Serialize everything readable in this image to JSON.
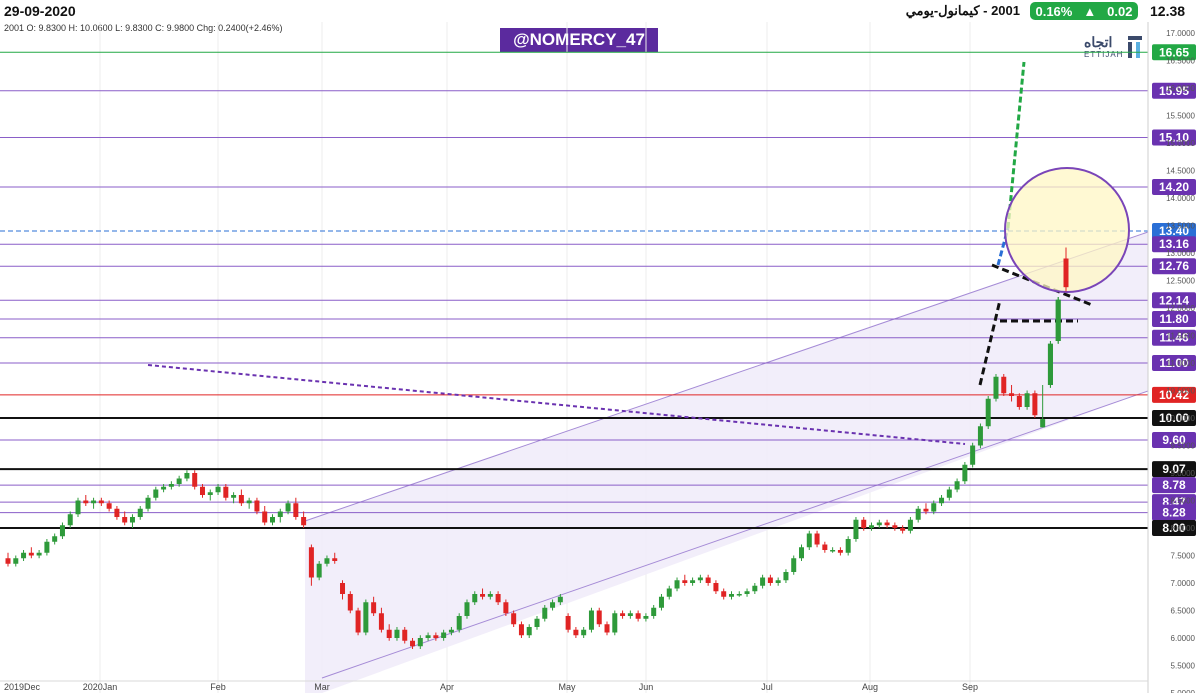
{
  "header": {
    "date": "29-09-2020",
    "title": "2001 - كيمانول-يومي",
    "change_pct": "0.16%",
    "change_abs": "0.02",
    "last_price": "12.38",
    "ohlc_line": "2001  O: 9.8300  H: 10.0600  L: 9.8300  C: 9.9800  Chg: 0.2400(+2.46%)"
  },
  "watermark": "@NOMERCY_47",
  "logo": {
    "arabic": "اتجاه",
    "english": "ETTIJAH"
  },
  "colors": {
    "up": "#2e9a3a",
    "down": "#e02424",
    "channel": "#a58bd6",
    "level": "#8a5ec8",
    "badge_purple": "#6a32b0",
    "badge_black": "#111111",
    "badge_red": "#e02424",
    "badge_green": "#22a845",
    "badge_blue": "#2a6fd6"
  },
  "chart_data": {
    "type": "candlestick",
    "x_labels": [
      "2019Dec",
      "2020Jan",
      "Feb",
      "Mar",
      "Apr",
      "May",
      "Jun",
      "Jul",
      "Aug",
      "Sep"
    ],
    "y_ticks": [
      "17.0000",
      "16.5000",
      "16.0000",
      "15.5000",
      "15.0000",
      "14.5000",
      "14.0000",
      "13.5000",
      "13.0000",
      "12.5000",
      "12.0000",
      "11.5000",
      "11.0000",
      "10.5000",
      "10.0000",
      "9.5000",
      "9.0000",
      "8.5000",
      "8.0000",
      "7.5000",
      "7.0000",
      "6.5000",
      "6.0000",
      "5.5000",
      "5.0000"
    ],
    "ylim": [
      5.0,
      17.2
    ],
    "price_levels": [
      {
        "value": 16.65,
        "label": "16.65",
        "style": "green"
      },
      {
        "value": 15.95,
        "label": "15.95",
        "style": "purple"
      },
      {
        "value": 15.1,
        "label": "15.10",
        "style": "purple"
      },
      {
        "value": 14.2,
        "label": "14.20",
        "style": "purple"
      },
      {
        "value": 13.4,
        "label": "13.40",
        "style": "blue"
      },
      {
        "value": 13.16,
        "label": "13.16",
        "style": "purple"
      },
      {
        "value": 12.76,
        "label": "12.76",
        "style": "purple"
      },
      {
        "value": 12.14,
        "label": "12.14",
        "style": "purple"
      },
      {
        "value": 11.8,
        "label": "11.80",
        "style": "purple"
      },
      {
        "value": 11.46,
        "label": "11.46",
        "style": "purple"
      },
      {
        "value": 11.0,
        "label": "11.00",
        "style": "purple"
      },
      {
        "value": 10.42,
        "label": "10.42",
        "style": "red"
      },
      {
        "value": 10.0,
        "label": "10.00",
        "style": "black"
      },
      {
        "value": 9.6,
        "label": "9.60",
        "style": "purple"
      },
      {
        "value": 9.07,
        "label": "9.07",
        "style": "black"
      },
      {
        "value": 8.78,
        "label": "8.78",
        "style": "purple"
      },
      {
        "value": 8.47,
        "label": "8.47",
        "style": "purple"
      },
      {
        "value": 8.28,
        "label": "8.28",
        "style": "purple"
      },
      {
        "value": 8.0,
        "label": "8.00",
        "style": "black"
      }
    ],
    "candles": [
      [
        7.45,
        7.55,
        7.3,
        7.35
      ],
      [
        7.35,
        7.5,
        7.3,
        7.45
      ],
      [
        7.45,
        7.6,
        7.4,
        7.55
      ],
      [
        7.55,
        7.65,
        7.45,
        7.5
      ],
      [
        7.5,
        7.6,
        7.45,
        7.55
      ],
      [
        7.55,
        7.8,
        7.5,
        7.75
      ],
      [
        7.75,
        7.9,
        7.7,
        7.85
      ],
      [
        7.85,
        8.1,
        7.8,
        8.05
      ],
      [
        8.05,
        8.3,
        8.0,
        8.25
      ],
      [
        8.25,
        8.55,
        8.2,
        8.5
      ],
      [
        8.5,
        8.6,
        8.4,
        8.45
      ],
      [
        8.45,
        8.55,
        8.35,
        8.5
      ],
      [
        8.5,
        8.55,
        8.4,
        8.45
      ],
      [
        8.45,
        8.5,
        8.3,
        8.35
      ],
      [
        8.35,
        8.4,
        8.15,
        8.2
      ],
      [
        8.2,
        8.3,
        8.05,
        8.1
      ],
      [
        8.1,
        8.25,
        8.0,
        8.2
      ],
      [
        8.2,
        8.4,
        8.15,
        8.35
      ],
      [
        8.35,
        8.6,
        8.3,
        8.55
      ],
      [
        8.55,
        8.75,
        8.5,
        8.7
      ],
      [
        8.7,
        8.8,
        8.65,
        8.75
      ],
      [
        8.75,
        8.85,
        8.7,
        8.8
      ],
      [
        8.8,
        8.95,
        8.75,
        8.9
      ],
      [
        8.9,
        9.05,
        8.85,
        9.0
      ],
      [
        9.0,
        9.05,
        8.7,
        8.75
      ],
      [
        8.75,
        8.8,
        8.55,
        8.6
      ],
      [
        8.6,
        8.7,
        8.5,
        8.65
      ],
      [
        8.65,
        8.8,
        8.6,
        8.75
      ],
      [
        8.75,
        8.8,
        8.5,
        8.55
      ],
      [
        8.55,
        8.65,
        8.45,
        8.6
      ],
      [
        8.6,
        8.7,
        8.4,
        8.45
      ],
      [
        8.45,
        8.55,
        8.35,
        8.5
      ],
      [
        8.5,
        8.55,
        8.25,
        8.3
      ],
      [
        8.3,
        8.4,
        8.05,
        8.1
      ],
      [
        8.1,
        8.25,
        8.05,
        8.2
      ],
      [
        8.2,
        8.35,
        8.1,
        8.3
      ],
      [
        8.3,
        8.5,
        8.25,
        8.45
      ],
      [
        8.45,
        8.55,
        8.15,
        8.2
      ],
      [
        8.2,
        8.3,
        8.0,
        8.05
      ],
      [
        7.65,
        7.7,
        6.95,
        7.1
      ],
      [
        7.1,
        7.4,
        7.05,
        7.35
      ],
      [
        7.35,
        7.5,
        7.3,
        7.45
      ],
      [
        7.45,
        7.55,
        7.35,
        7.4
      ],
      [
        7.0,
        7.05,
        6.7,
        6.8
      ],
      [
        6.8,
        6.85,
        6.45,
        6.5
      ],
      [
        6.5,
        6.55,
        6.05,
        6.1
      ],
      [
        6.1,
        6.7,
        6.05,
        6.65
      ],
      [
        6.65,
        6.75,
        6.4,
        6.45
      ],
      [
        6.45,
        6.55,
        6.1,
        6.15
      ],
      [
        6.15,
        6.25,
        5.95,
        6.0
      ],
      [
        6.0,
        6.2,
        5.95,
        6.15
      ],
      [
        6.15,
        6.2,
        5.9,
        5.95
      ],
      [
        5.95,
        6.0,
        5.8,
        5.85
      ],
      [
        5.85,
        6.05,
        5.8,
        6.0
      ],
      [
        6.0,
        6.1,
        5.95,
        6.05
      ],
      [
        6.05,
        6.1,
        5.95,
        6.0
      ],
      [
        6.0,
        6.15,
        5.95,
        6.1
      ],
      [
        6.1,
        6.2,
        6.05,
        6.15
      ],
      [
        6.15,
        6.45,
        6.1,
        6.4
      ],
      [
        6.4,
        6.7,
        6.35,
        6.65
      ],
      [
        6.65,
        6.85,
        6.6,
        6.8
      ],
      [
        6.8,
        6.9,
        6.7,
        6.75
      ],
      [
        6.75,
        6.85,
        6.7,
        6.8
      ],
      [
        6.8,
        6.85,
        6.6,
        6.65
      ],
      [
        6.65,
        6.7,
        6.4,
        6.45
      ],
      [
        6.45,
        6.5,
        6.2,
        6.25
      ],
      [
        6.25,
        6.3,
        6.0,
        6.05
      ],
      [
        6.05,
        6.25,
        6.0,
        6.2
      ],
      [
        6.2,
        6.4,
        6.15,
        6.35
      ],
      [
        6.35,
        6.6,
        6.3,
        6.55
      ],
      [
        6.55,
        6.7,
        6.5,
        6.65
      ],
      [
        6.65,
        6.8,
        6.6,
        6.75
      ],
      [
        6.4,
        6.45,
        6.1,
        6.15
      ],
      [
        6.15,
        6.2,
        6.0,
        6.05
      ],
      [
        6.05,
        6.2,
        6.0,
        6.15
      ],
      [
        6.15,
        6.55,
        6.1,
        6.5
      ],
      [
        6.5,
        6.55,
        6.2,
        6.25
      ],
      [
        6.25,
        6.3,
        6.05,
        6.1
      ],
      [
        6.1,
        6.5,
        6.05,
        6.45
      ],
      [
        6.45,
        6.5,
        6.35,
        6.4
      ],
      [
        6.4,
        6.5,
        6.35,
        6.45
      ],
      [
        6.45,
        6.5,
        6.3,
        6.35
      ],
      [
        6.35,
        6.45,
        6.3,
        6.4
      ],
      [
        6.4,
        6.6,
        6.35,
        6.55
      ],
      [
        6.55,
        6.8,
        6.5,
        6.75
      ],
      [
        6.75,
        6.95,
        6.7,
        6.9
      ],
      [
        6.9,
        7.1,
        6.85,
        7.05
      ],
      [
        7.05,
        7.15,
        6.95,
        7.0
      ],
      [
        7.0,
        7.1,
        6.95,
        7.05
      ],
      [
        7.05,
        7.15,
        7.0,
        7.1
      ],
      [
        7.1,
        7.15,
        6.95,
        7.0
      ],
      [
        7.0,
        7.05,
        6.8,
        6.85
      ],
      [
        6.85,
        6.9,
        6.7,
        6.75
      ],
      [
        6.75,
        6.85,
        6.7,
        6.8
      ],
      [
        6.8,
        6.85,
        6.75,
        6.8
      ],
      [
        6.8,
        6.9,
        6.75,
        6.85
      ],
      [
        6.85,
        7.0,
        6.8,
        6.95
      ],
      [
        6.95,
        7.15,
        6.9,
        7.1
      ],
      [
        7.1,
        7.15,
        6.95,
        7.0
      ],
      [
        7.0,
        7.1,
        6.95,
        7.05
      ],
      [
        7.05,
        7.25,
        7.0,
        7.2
      ],
      [
        7.2,
        7.5,
        7.15,
        7.45
      ],
      [
        7.45,
        7.7,
        7.4,
        7.65
      ],
      [
        7.65,
        7.95,
        7.6,
        7.9
      ],
      [
        7.9,
        7.95,
        7.65,
        7.7
      ],
      [
        7.7,
        7.75,
        7.55,
        7.6
      ],
      [
        7.6,
        7.65,
        7.55,
        7.6
      ],
      [
        7.6,
        7.65,
        7.5,
        7.55
      ],
      [
        7.55,
        7.85,
        7.5,
        7.8
      ],
      [
        7.8,
        8.2,
        7.75,
        8.15
      ],
      [
        8.15,
        8.2,
        7.95,
        8.0
      ],
      [
        8.0,
        8.1,
        7.95,
        8.05
      ],
      [
        8.05,
        8.15,
        8.0,
        8.1
      ],
      [
        8.1,
        8.15,
        8.0,
        8.05
      ],
      [
        8.05,
        8.1,
        7.95,
        8.0
      ],
      [
        8.0,
        8.05,
        7.9,
        7.95
      ],
      [
        7.95,
        8.2,
        7.9,
        8.15
      ],
      [
        8.15,
        8.4,
        8.1,
        8.35
      ],
      [
        8.35,
        8.45,
        8.25,
        8.3
      ],
      [
        8.3,
        8.5,
        8.25,
        8.45
      ],
      [
        8.45,
        8.6,
        8.4,
        8.55
      ],
      [
        8.55,
        8.75,
        8.5,
        8.7
      ],
      [
        8.7,
        8.9,
        8.65,
        8.85
      ],
      [
        8.85,
        9.2,
        8.8,
        9.15
      ],
      [
        9.15,
        9.55,
        9.1,
        9.5
      ],
      [
        9.5,
        9.9,
        9.45,
        9.85
      ],
      [
        9.85,
        10.4,
        9.8,
        10.35
      ],
      [
        10.35,
        10.8,
        10.3,
        10.75
      ],
      [
        10.75,
        10.8,
        10.4,
        10.45
      ],
      [
        10.45,
        10.6,
        10.3,
        10.4
      ],
      [
        10.4,
        10.45,
        10.15,
        10.2
      ],
      [
        10.2,
        10.5,
        10.15,
        10.45
      ],
      [
        10.45,
        10.5,
        10.0,
        10.05
      ],
      [
        9.83,
        10.6,
        9.83,
        9.98
      ],
      [
        10.6,
        11.4,
        10.55,
        11.35
      ],
      [
        11.4,
        12.2,
        11.35,
        12.15
      ],
      [
        12.9,
        13.1,
        12.3,
        12.38
      ]
    ]
  }
}
